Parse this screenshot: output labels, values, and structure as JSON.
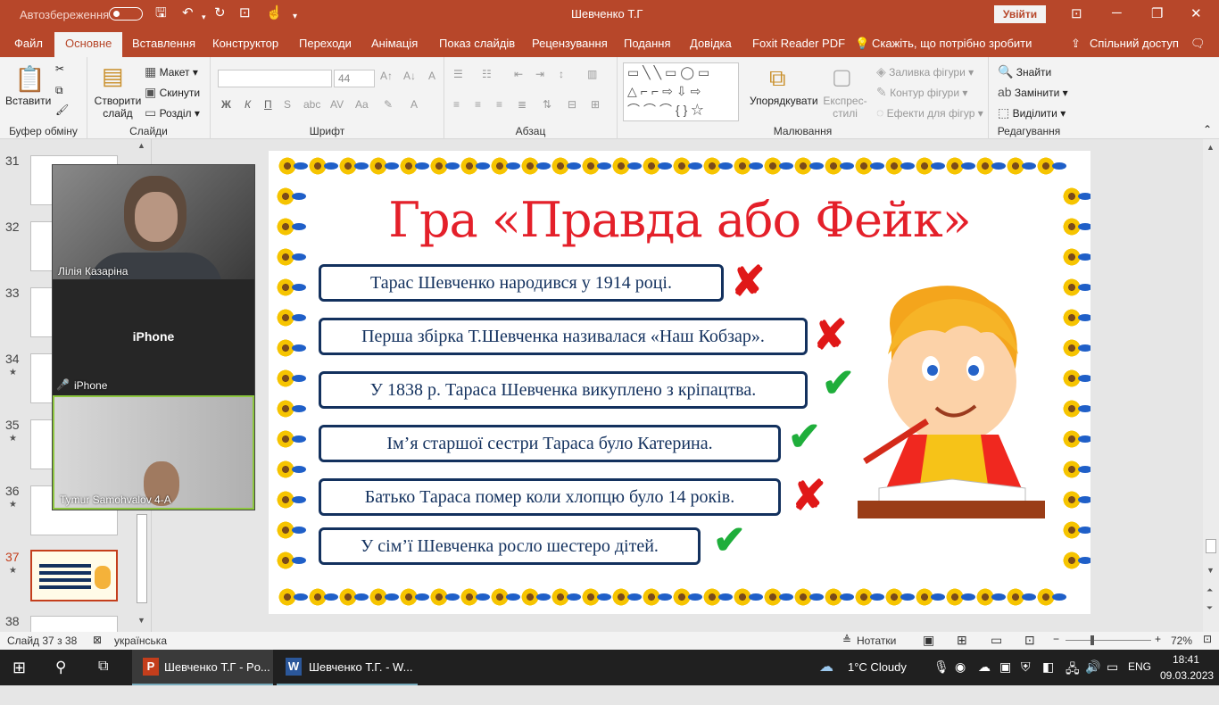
{
  "titlebar": {
    "autosave_label": "Автозбереження",
    "doc_title": "Шевченко Т.Г",
    "signin_label": "Увійти",
    "icons": [
      "save-icon",
      "undo-icon",
      "redo-icon",
      "present-icon",
      "touch-mode-icon",
      "customize-icon"
    ]
  },
  "tabs": [
    {
      "label": "Файл"
    },
    {
      "label": "Основне",
      "active": true
    },
    {
      "label": "Вставлення"
    },
    {
      "label": "Конструктор"
    },
    {
      "label": "Переходи"
    },
    {
      "label": "Анімація"
    },
    {
      "label": "Показ слайдів"
    },
    {
      "label": "Рецензування"
    },
    {
      "label": "Подання"
    },
    {
      "label": "Довідка"
    },
    {
      "label": "Foxit Reader PDF"
    }
  ],
  "tell_me": "Скажіть, що потрібно зробити",
  "share": "Спільний доступ",
  "ribbon": {
    "clipboard": {
      "paste": "Вставити",
      "group": "Буфер обміну"
    },
    "slides": {
      "new_slide": "Створити слайд",
      "layout": "Макет",
      "reset": "Скинути",
      "section": "Розділ",
      "group": "Слайди"
    },
    "font": {
      "font_name": "",
      "font_size": "44",
      "bold": "Ж",
      "italic": "К",
      "underline": "П",
      "group": "Шрифт"
    },
    "paragraph": {
      "group": "Абзац"
    },
    "drawing": {
      "arrange": "Упорядкувати",
      "quick_styles": "Експрес-стилі",
      "shape_fill": "Заливка фігури",
      "shape_outline": "Контур фігури",
      "shape_effects": "Ефекти для фігур",
      "group": "Малювання"
    },
    "editing": {
      "find": "Знайти",
      "replace": "Замінити",
      "select": "Виділити",
      "group": "Редагування"
    }
  },
  "thumbnails": [
    {
      "num": "31",
      "star": false
    },
    {
      "num": "32",
      "star": false
    },
    {
      "num": "33",
      "star": false
    },
    {
      "num": "34",
      "star": true
    },
    {
      "num": "35",
      "star": true
    },
    {
      "num": "36",
      "star": true
    },
    {
      "num": "37",
      "star": true,
      "selected": true
    },
    {
      "num": "38",
      "star": false
    }
  ],
  "video": {
    "participant1": "Лілія Казаріна",
    "participant2_center": "iPhone",
    "participant2_name": "iPhone",
    "participant3": "Tymur Samohvalov 4-А"
  },
  "slide": {
    "title": "Гра «Правда або Фейк»",
    "statements": [
      {
        "text": "Тарас Шевченко народився у 1914 році.",
        "mark": "✘"
      },
      {
        "text": "Перша збірка Т.Шевченка називалася «Наш Кобзар».",
        "mark": "✘"
      },
      {
        "text": "У 1838 р. Тараса Шевченка викуплено з кріпацтва.",
        "mark": "✔"
      },
      {
        "text": "Ім’я старшої сестри Тараса було Катерина.",
        "mark": "✔"
      },
      {
        "text": "Батько Тараса помер коли хлопцю було 14 років.",
        "mark": "✘"
      },
      {
        "text": "У сім’ї Шевченка росло шестеро дітей.",
        "mark": "✔"
      }
    ]
  },
  "status": {
    "slide_info": "Слайд 37 з 38",
    "language": "українська",
    "notes": "Нотатки",
    "zoom": "72%"
  },
  "taskbar": {
    "app1": "Шевченко Т.Г - Po...",
    "app2": "Шевченко Т.Г. - W...",
    "weather": "1°C  Cloudy",
    "lang": "ENG",
    "time": "18:41",
    "date": "09.03.2023"
  }
}
